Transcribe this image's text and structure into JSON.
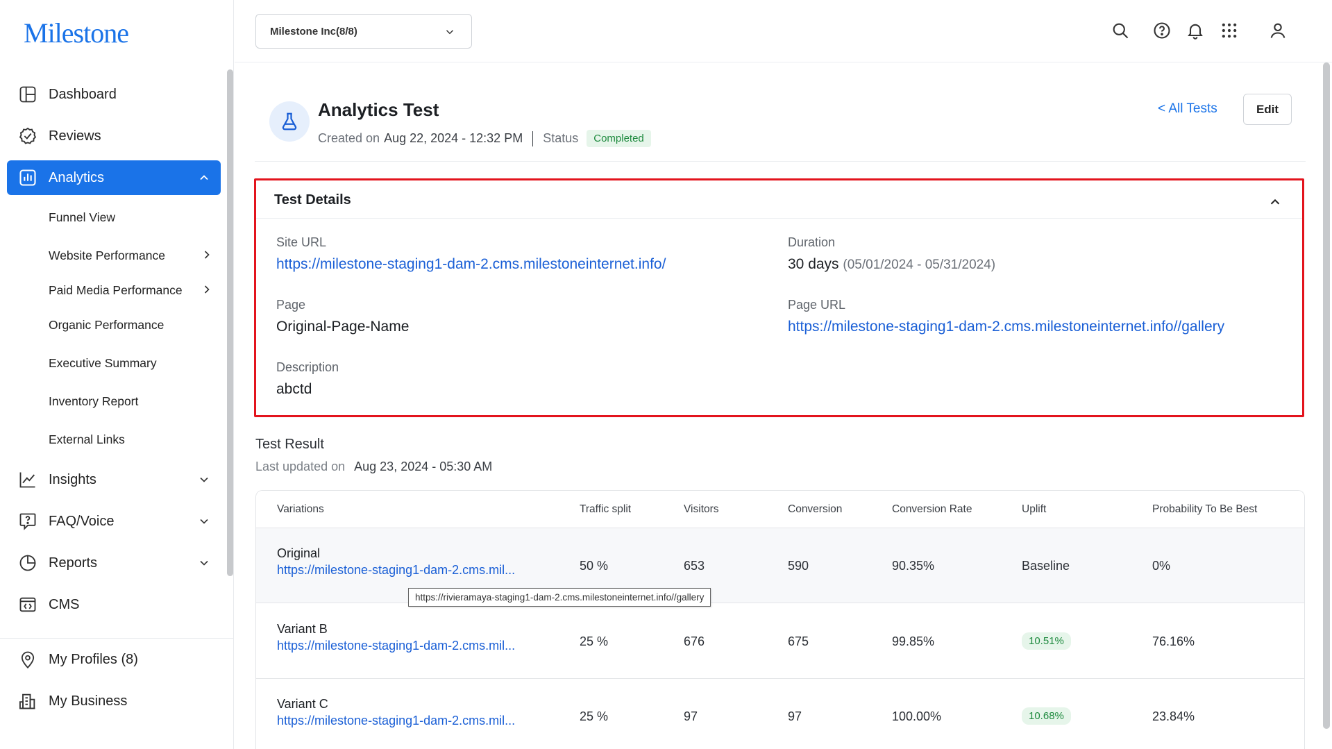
{
  "brand": {
    "logo_text": "Milestone",
    "accent": "#1a73e8"
  },
  "sidebar": {
    "items": [
      {
        "label": "Dashboard",
        "icon": "dashboard-icon"
      },
      {
        "label": "Reviews",
        "icon": "check-circle-icon"
      },
      {
        "label": "Analytics",
        "icon": "bar-chart-icon",
        "active": true
      },
      {
        "label": "Insights",
        "icon": "line-chart-icon"
      },
      {
        "label": "FAQ/Voice",
        "icon": "faq-icon"
      },
      {
        "label": "Reports",
        "icon": "pie-chart-icon"
      },
      {
        "label": "CMS",
        "icon": "code-window-icon"
      },
      {
        "label": "My Profiles (8)",
        "icon": "location-pin-icon"
      },
      {
        "label": "My Business",
        "icon": "building-icon"
      }
    ],
    "analytics_sub": [
      "Funnel View",
      "Website Performance",
      "Paid Media Performance",
      "Organic Performance",
      "Executive Summary",
      "Inventory Report",
      "External Links"
    ]
  },
  "header": {
    "org_selector": "Milestone Inc(8/8)",
    "icons": [
      "search-icon",
      "help-icon",
      "bell-icon",
      "apps-grid-icon",
      "user-icon"
    ]
  },
  "test": {
    "title": "Analytics Test",
    "created_label": "Created on",
    "created_value": "Aug 22, 2024 - 12:32 PM",
    "status_label": "Status",
    "status_value": "Completed",
    "all_tests": "< All Tests",
    "edit": "Edit"
  },
  "details": {
    "title": "Test Details",
    "site_url_label": "Site URL",
    "site_url": "https://milestone-staging1-dam-2.cms.milestoneinternet.info/",
    "duration_label": "Duration",
    "duration_value": "30 days",
    "duration_range": "(05/01/2024 - 05/31/2024)",
    "page_label": "Page",
    "page_value": "Original-Page-Name",
    "page_url_label": "Page URL",
    "page_url": "https://milestone-staging1-dam-2.cms.milestoneinternet.info//gallery",
    "description_label": "Description",
    "description_value": "abctd"
  },
  "result": {
    "title": "Test Result",
    "updated_label": "Last updated on",
    "updated_value": "Aug 23, 2024 - 05:30 AM",
    "columns": [
      "Variations",
      "Traffic split",
      "Visitors",
      "Conversion",
      "Conversion Rate",
      "Uplift",
      "Probability To Be Best"
    ],
    "rows": [
      {
        "name": "Original",
        "url": "https://milestone-staging1-dam-2.cms.mil...",
        "split": "50 %",
        "visitors": "653",
        "conversion": "590",
        "rate": "90.35%",
        "uplift": "Baseline",
        "prob": "0%"
      },
      {
        "name": "Variant B",
        "url": "https://milestone-staging1-dam-2.cms.mil...",
        "split": "25 %",
        "visitors": "676",
        "conversion": "675",
        "rate": "99.85%",
        "uplift": "10.51%",
        "prob": "76.16%"
      },
      {
        "name": "Variant C",
        "url": "https://milestone-staging1-dam-2.cms.mil...",
        "split": "25 %",
        "visitors": "97",
        "conversion": "97",
        "rate": "100.00%",
        "uplift": "10.68%",
        "prob": "23.84%"
      }
    ],
    "tooltip": "https://rivieramaya-staging1-dam-2.cms.milestoneinternet.info//gallery"
  }
}
